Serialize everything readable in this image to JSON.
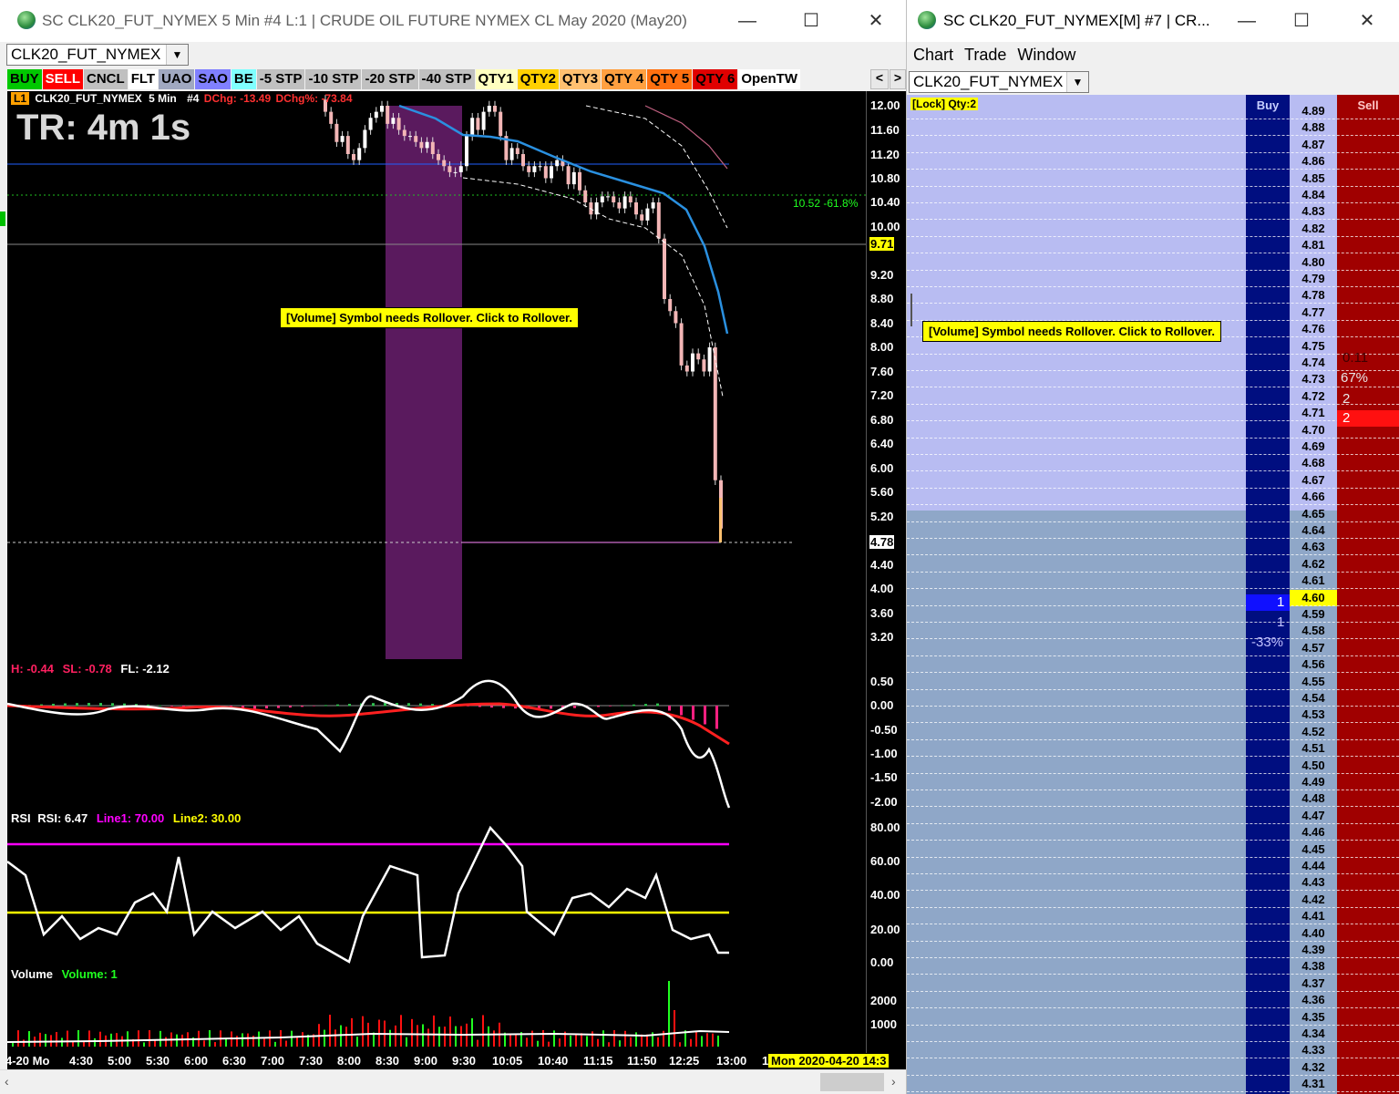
{
  "left_window": {
    "title": "SC CLK20_FUT_NYMEX  5 Min   #4  L:1 | CRUDE OIL FUTURE NYMEX CL May 2020 (May20)",
    "symbol": "CLK20_FUT_NYMEX",
    "controls": {
      "minimize": "—",
      "maximize": "☐",
      "close": "✕"
    },
    "toolbar": [
      {
        "label": "BUY",
        "bg": "#00c800",
        "fg": "#000000"
      },
      {
        "label": "SELL",
        "bg": "#ff0000",
        "fg": "#ffffff"
      },
      {
        "label": "CNCL",
        "bg": "#c0c0c0",
        "fg": "#000000"
      },
      {
        "label": "FLT",
        "bg": "#ffffff",
        "fg": "#000000"
      },
      {
        "label": "UAO",
        "bg": "#a0a8c0",
        "fg": "#000000"
      },
      {
        "label": "SAO",
        "bg": "#8080ff",
        "fg": "#000000"
      },
      {
        "label": "BE",
        "bg": "#80ffff",
        "fg": "#000000"
      },
      {
        "label": "-5 STP",
        "bg": "#c0c0c0",
        "fg": "#000000"
      },
      {
        "label": "-10 STP",
        "bg": "#c0c0c0",
        "fg": "#000000"
      },
      {
        "label": "-20 STP",
        "bg": "#c0c0c0",
        "fg": "#000000"
      },
      {
        "label": "-40 STP",
        "bg": "#c0c0c0",
        "fg": "#000000"
      },
      {
        "label": "QTY1",
        "bg": "#ffffc0",
        "fg": "#000000"
      },
      {
        "label": "QTY2",
        "bg": "#ffd000",
        "fg": "#000000"
      },
      {
        "label": "QTY3",
        "bg": "#ffc070",
        "fg": "#000000"
      },
      {
        "label": "QTY 4",
        "bg": "#ffa040",
        "fg": "#000000"
      },
      {
        "label": "QTY 5",
        "bg": "#ff7010",
        "fg": "#000000"
      },
      {
        "label": "QTY 6",
        "bg": "#e00000",
        "fg": "#000000"
      },
      {
        "label": "OpenTW",
        "bg": "#ffffff",
        "fg": "#000000"
      }
    ],
    "nav_prev": "<",
    "nav_next": ">",
    "chart_header": {
      "badge": "L1",
      "symbol": "CLK20_FUT_NYMEX",
      "interval": "5 Min",
      "num": "#4",
      "dchg": "DChg: -13.49",
      "dchg_pct": "DChg%: -73.84"
    },
    "timer": "TR: 4m 1s",
    "fib_label": "10.52 -61.8%",
    "rollover_msg": "[Volume] Symbol needs Rollover. Click to Rollover.",
    "price_ticks": [
      "12.00",
      "11.60",
      "11.20",
      "10.80",
      "10.40",
      "10.00",
      "9.20",
      "8.80",
      "8.40",
      "8.00",
      "7.60",
      "7.20",
      "6.80",
      "6.40",
      "6.00",
      "5.60",
      "5.20",
      "4.40",
      "4.00",
      "3.60",
      "3.20"
    ],
    "last_price_box": "9.71",
    "current_price_box": "4.78",
    "macd": {
      "h": "H: -0.44",
      "sl": "SL: -0.78",
      "fl": "FL: -2.12",
      "ticks": [
        "0.50",
        "0.00",
        "-0.50",
        "-1.00",
        "-1.50",
        "-2.00"
      ]
    },
    "rsi": {
      "name": "RSI",
      "value": "RSI: 6.47",
      "line1": "Line1: 70.00",
      "line2": "Line2: 30.00",
      "ticks": [
        "80.00",
        "60.00",
        "40.00",
        "20.00",
        "0.00"
      ]
    },
    "volume": {
      "name": "Volume",
      "value": "Volume: 1",
      "ticks": [
        "2000",
        "1000"
      ]
    },
    "time_ticks": [
      "4-20 Mo",
      "4:30",
      "5:00",
      "5:30",
      "6:00",
      "6:30",
      "7:00",
      "7:30",
      "8:00",
      "8:30",
      "9:00",
      "9:30",
      "10:05",
      "10:40",
      "11:15",
      "11:50",
      "12:25",
      "13:00",
      "1"
    ],
    "date_box": "Mon 2020-04-20  14:3",
    "colors": {
      "ema": "#2a90e0",
      "rsi_l1": "#ff00ff",
      "rsi_l2": "#ffff00",
      "shade": "#5a1a5e"
    }
  },
  "right_window": {
    "title": "SC CLK20_FUT_NYMEX[M]  #7 | CR...",
    "controls": {
      "minimize": "—",
      "maximize": "☐",
      "close": "✕"
    },
    "menu": [
      "Chart",
      "Trade",
      "Window"
    ],
    "symbol": "CLK20_FUT_NYMEX",
    "lock": "[Lock] Qty:2",
    "buy_header": "Buy",
    "sell_header": "Sell",
    "rollover_msg": "[Volume] Symbol needs Rollover. Click to Rollover.",
    "prices": [
      "4.89",
      "4.88",
      "4.87",
      "4.86",
      "4.85",
      "4.84",
      "4.83",
      "4.82",
      "4.81",
      "4.80",
      "4.79",
      "4.78",
      "4.77",
      "4.76",
      "4.75",
      "4.74",
      "4.73",
      "4.72",
      "4.71",
      "4.70",
      "4.69",
      "4.68",
      "4.67",
      "4.66",
      "4.65",
      "4.64",
      "4.63",
      "4.62",
      "4.61",
      "4.60",
      "4.59",
      "4.58",
      "4.57",
      "4.56",
      "4.55",
      "4.54",
      "4.53",
      "4.52",
      "4.51",
      "4.50",
      "4.49",
      "4.48",
      "4.47",
      "4.46",
      "4.45",
      "4.44",
      "4.43",
      "4.42",
      "4.41",
      "4.40",
      "4.39",
      "4.38",
      "4.37",
      "4.36",
      "4.35",
      "4.34",
      "4.33",
      "4.32",
      "4.31"
    ],
    "current_price": "4.60",
    "sell_side": {
      "v1": "0.11",
      "pct": "67%",
      "q1": "2",
      "q2": "2"
    },
    "buy_side": {
      "q1": "1",
      "q2": "1",
      "pct": "-33%"
    }
  }
}
